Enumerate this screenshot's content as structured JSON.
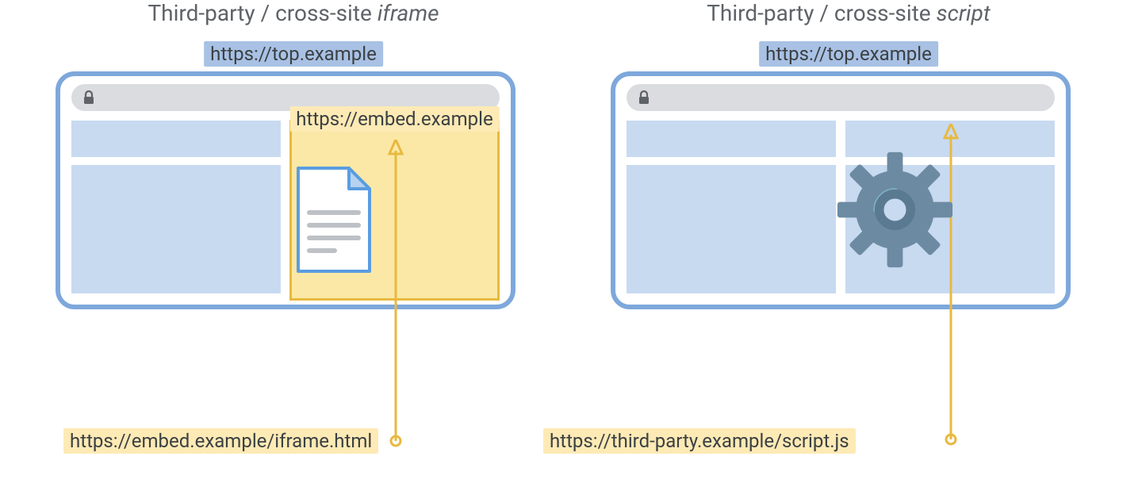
{
  "left": {
    "title_prefix": "Third-party / cross-site ",
    "title_em": "iframe",
    "top_url": "https://top.example",
    "embed_label": "https://embed.example",
    "bottom_url": "https://embed.example/iframe.html"
  },
  "right": {
    "title_prefix": "Third-party / cross-site ",
    "title_em": "script",
    "top_url": "https://top.example",
    "bottom_url": "https://third-party.example/script.js"
  }
}
